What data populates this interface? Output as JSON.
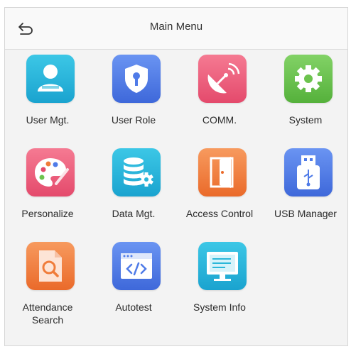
{
  "header": {
    "title": "Main Menu",
    "back_icon": "back-arrow-icon"
  },
  "menu": [
    {
      "label": "User Mgt.",
      "icon": "user-icon",
      "color": "#2bb7d9"
    },
    {
      "label": "User Role",
      "icon": "shield-key-icon",
      "color": "#4f7be8"
    },
    {
      "label": "COMM.",
      "icon": "satellite-dish-icon",
      "color": "#ef5b7b"
    },
    {
      "label": "System",
      "icon": "gear-icon",
      "color": "#6cc34e"
    },
    {
      "label": "Personalize",
      "icon": "palette-icon",
      "color": "#ef5b7b"
    },
    {
      "label": "Data Mgt.",
      "icon": "database-gear-icon",
      "color": "#2bb7d9"
    },
    {
      "label": "Access Control",
      "icon": "door-icon",
      "color": "#f07c3a"
    },
    {
      "label": "USB Manager",
      "icon": "usb-drive-icon",
      "color": "#4f7be8"
    },
    {
      "label": "Attendance\nSearch",
      "icon": "document-search-icon",
      "color": "#f07c3a"
    },
    {
      "label": "Autotest",
      "icon": "code-window-icon",
      "color": "#4f7be8"
    },
    {
      "label": "System Info",
      "icon": "monitor-icon",
      "color": "#2bb7d9"
    }
  ]
}
